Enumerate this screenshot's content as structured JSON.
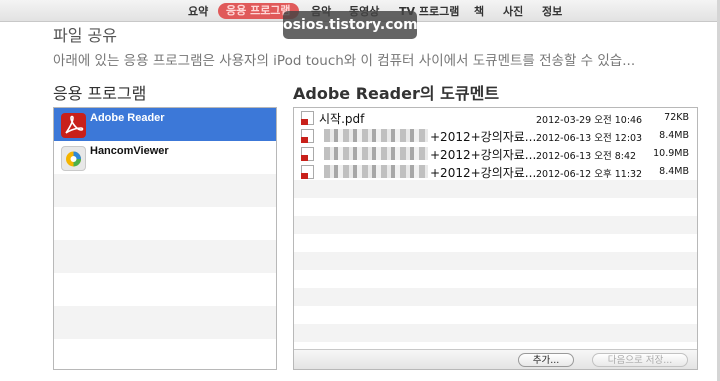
{
  "tabs": [
    {
      "label": "요약",
      "active": false
    },
    {
      "label": "응용 프로그램",
      "active": true
    },
    {
      "label": "음악",
      "active": false
    },
    {
      "label": "동영상",
      "active": false
    },
    {
      "label": "TV 프로그램",
      "active": false
    },
    {
      "label": "책",
      "active": false
    },
    {
      "label": "사진",
      "active": false
    },
    {
      "label": "정보",
      "active": false
    }
  ],
  "watermark": "osios.tistory.com",
  "file_sharing": {
    "title": "파일 공유",
    "description": "아래에 있는 응용 프로그램은 사용자의 iPod touch와 이 컴퓨터 사이에서 도큐멘트를 전송할 수 있습..."
  },
  "apps": {
    "title": "응용 프로그램",
    "items": [
      {
        "name": "Adobe Reader",
        "icon": "adobe-reader-icon",
        "selected": true
      },
      {
        "name": "HancomViewer",
        "icon": "hancom-viewer-icon",
        "selected": false
      }
    ]
  },
  "documents": {
    "title": "Adobe Reader의 도큐멘트",
    "items": [
      {
        "name": "시작.pdf",
        "date": "2012-03-29 오전 10:46",
        "size": "72KB"
      },
      {
        "name": "+2012+강의자료...",
        "date": "2012-06-13 오전 12:03",
        "size": "8.4MB"
      },
      {
        "name": "+2012+강의자료...",
        "date": "2012-06-13 오전 8:42",
        "size": "10.9MB"
      },
      {
        "name": "+2012+강의자료...",
        "date": "2012-06-12 오후 11:32",
        "size": "8.4MB"
      }
    ],
    "add_button": "추가...",
    "save_button": "다음으로 저장..."
  },
  "colors": {
    "accent_selected": "#3c78d8",
    "active_tab": "#e05a5a"
  }
}
